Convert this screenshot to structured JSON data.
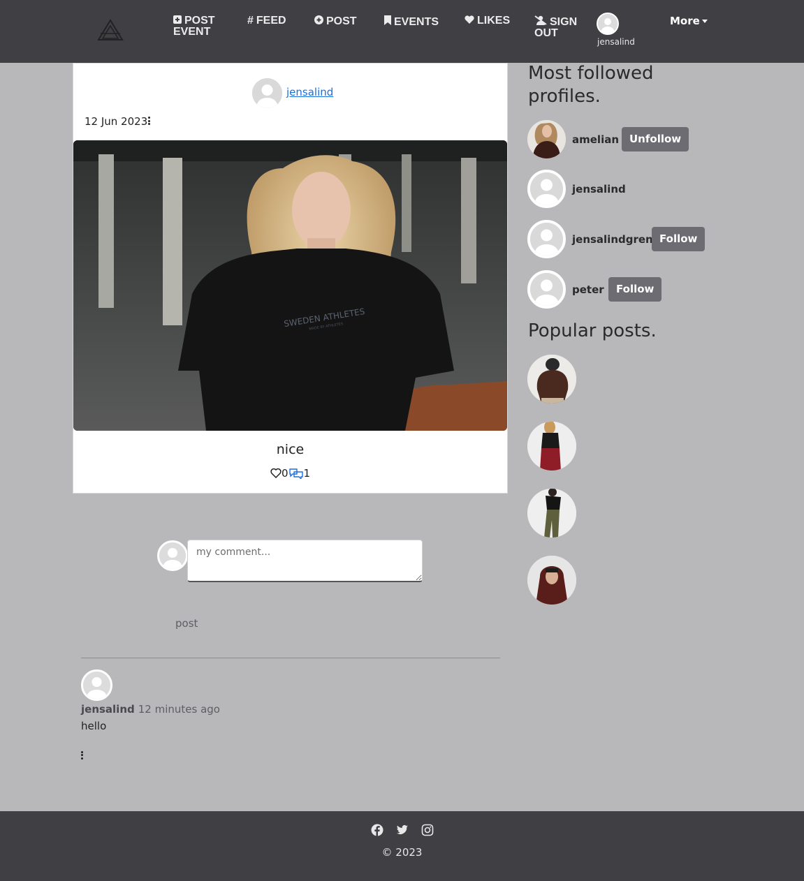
{
  "nav": {
    "logo_icon": "triangle-logo-icon",
    "items": [
      {
        "label": "POST EVENT",
        "icon": "plus-square-icon"
      },
      {
        "label": "FEED",
        "icon": "hash-icon"
      },
      {
        "label": "POST",
        "icon": "plus-circle-icon"
      },
      {
        "label": "EVENTS",
        "icon": "bookmark-icon"
      },
      {
        "label": "LIKES",
        "icon": "heart-icon"
      },
      {
        "label": "SIGN OUT",
        "icon": "user-slash-icon"
      }
    ],
    "user": "jensalind",
    "more": "More"
  },
  "post": {
    "author": "jensalind",
    "date": "12 Jun 2023",
    "caption": "nice",
    "likes": "0",
    "comments": "1",
    "image_text": "SWEDEN ATHLETES",
    "image_subtext": "MADE BY ATHLETES"
  },
  "comment_form": {
    "placeholder": "my comment...",
    "submit_label": "post"
  },
  "comments": [
    {
      "user": "jensalind",
      "time": "12 minutes ago",
      "text": "hello"
    }
  ],
  "sidebar": {
    "profiles_title": "Most followed profiles.",
    "profiles": [
      {
        "name": "amelian",
        "button": "Unfollow"
      },
      {
        "name": "jensalind",
        "button": ""
      },
      {
        "name": "jensalindgren",
        "button": "Follow"
      },
      {
        "name": "peter",
        "button": "Follow"
      }
    ],
    "popular_title": "Popular posts."
  },
  "footer": {
    "social": [
      "facebook-icon",
      "twitter-icon",
      "instagram-icon"
    ],
    "copyright": "© 2023"
  },
  "colors": {
    "navbar": "#3f3f44",
    "page_bg": "#b8b8bb",
    "link": "#1a6fdc",
    "button": "#6c6c72"
  }
}
